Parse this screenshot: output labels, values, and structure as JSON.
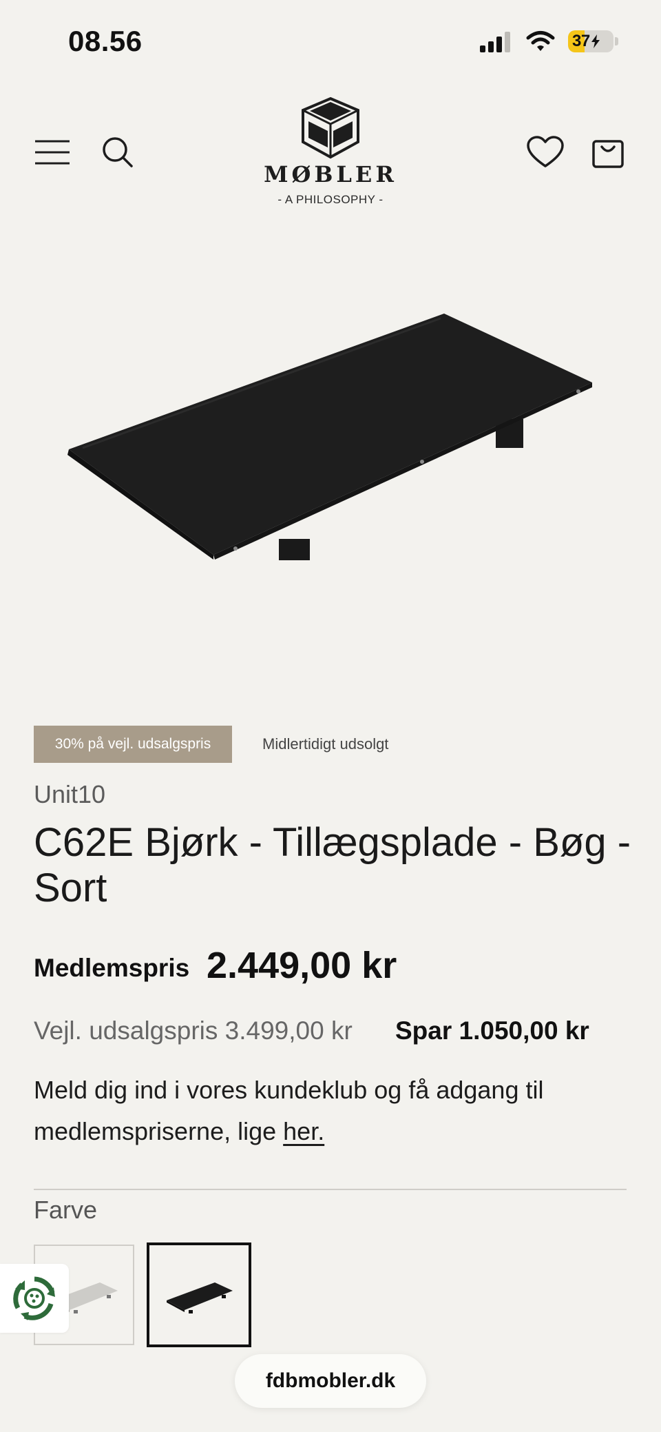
{
  "status_bar": {
    "time": "08.56",
    "battery_percent": 37,
    "battery_label": "37",
    "icons": [
      "signal-icon",
      "wifi-icon",
      "battery-charging-icon"
    ]
  },
  "header": {
    "logo_word": "MØBLER",
    "logo_tagline": "- A PHILOSOPHY -",
    "icons": [
      "menu-icon",
      "search-icon",
      "heart-icon",
      "bag-icon"
    ]
  },
  "product": {
    "badge_sale": "30% på vejl. udsalgspris",
    "badge_stock": "Midlertidigt udsolgt",
    "brand": "Unit10",
    "title": "C62E Bjørk - Tillægsplade - Bøg - Sort",
    "member_label": "Medlemspris",
    "member_price": "2.449,00 kr",
    "rrp": "Vejl. udsalgspris 3.499,00 kr",
    "save": "Spar 1.050,00 kr",
    "promo_text": "Meld dig ind i vores kundeklub og få adgang til medlemspriserne, lige ",
    "promo_link": "her."
  },
  "variants": {
    "label": "Farve",
    "swatches": [
      {
        "name": "light",
        "color": "#c9c8c4",
        "selected": false
      },
      {
        "name": "black",
        "color": "#1b1b1b",
        "selected": true
      }
    ]
  },
  "browser": {
    "url": "fdbmobler.dk"
  },
  "colors": {
    "background": "#f3f2ee",
    "sale_badge": "#a89c8a",
    "eco_green": "#2e6b3a"
  }
}
